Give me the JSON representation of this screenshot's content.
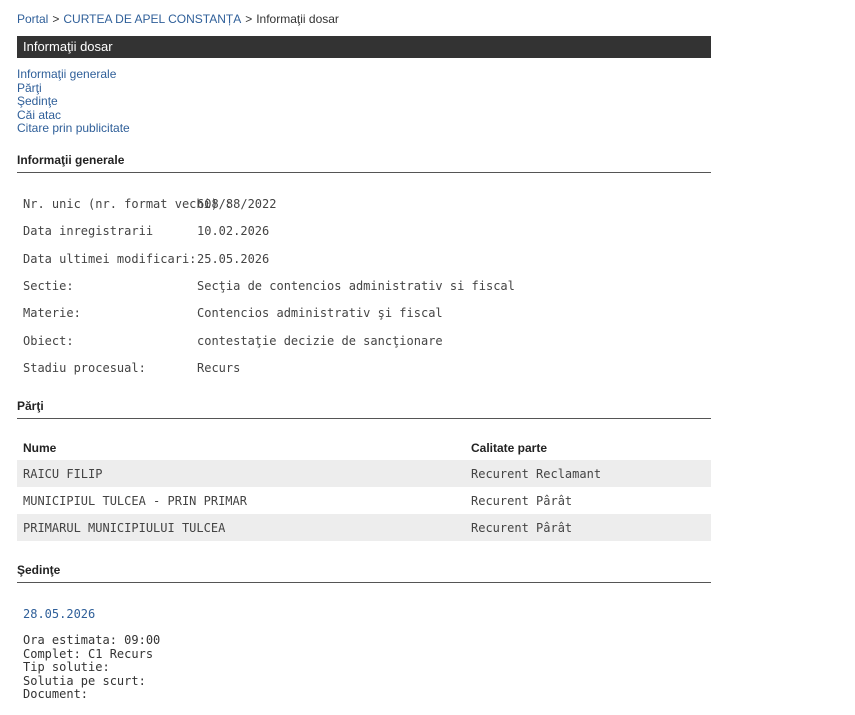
{
  "breadcrumb": {
    "portal": "Portal",
    "sep1": ">",
    "court": "CURTEA DE APEL CONSTANȚA",
    "sep2": ">",
    "current": "Informaţii dosar"
  },
  "title": "Informaţii dosar",
  "section_links": [
    "Informaţii generale",
    "Părţi",
    "Şedinţe",
    "Căi atac",
    "Citare prin publicitate"
  ],
  "general": {
    "heading": "Informaţii generale",
    "rows": [
      {
        "label": "Nr. unic (nr. format vechi) :",
        "value": "608/88/2022"
      },
      {
        "label": "Data inregistrarii",
        "value": "10.02.2026"
      },
      {
        "label": "Data ultimei modificari:",
        "value": "25.05.2026"
      },
      {
        "label": "Sectie:",
        "value": "Secţia de contencios administrativ si fiscal"
      },
      {
        "label": "Materie:",
        "value": "Contencios administrativ şi fiscal"
      },
      {
        "label": "Obiect:",
        "value": "contestaţie decizie de sancţionare"
      },
      {
        "label": "Stadiu procesual:",
        "value": "Recurs"
      }
    ]
  },
  "parti": {
    "heading": "Părţi",
    "columns": [
      "Nume",
      "Calitate parte"
    ],
    "rows": [
      {
        "nume": "RAICU FILIP",
        "calitate": "Recurent Reclamant"
      },
      {
        "nume": "MUNICIPIUL TULCEA - PRIN PRIMAR",
        "calitate": "Recurent Pârât"
      },
      {
        "nume": "PRIMARUL MUNICIPIULUI TULCEA",
        "calitate": "Recurent Pârât"
      }
    ]
  },
  "sedinte": {
    "heading": "Şedinţe",
    "date": "28.05.2026",
    "lines": [
      "Ora estimata: 09:00",
      "Complet: C1 Recurs",
      "Tip solutie:",
      "Solutia pe scurt:",
      "Document:"
    ]
  }
}
